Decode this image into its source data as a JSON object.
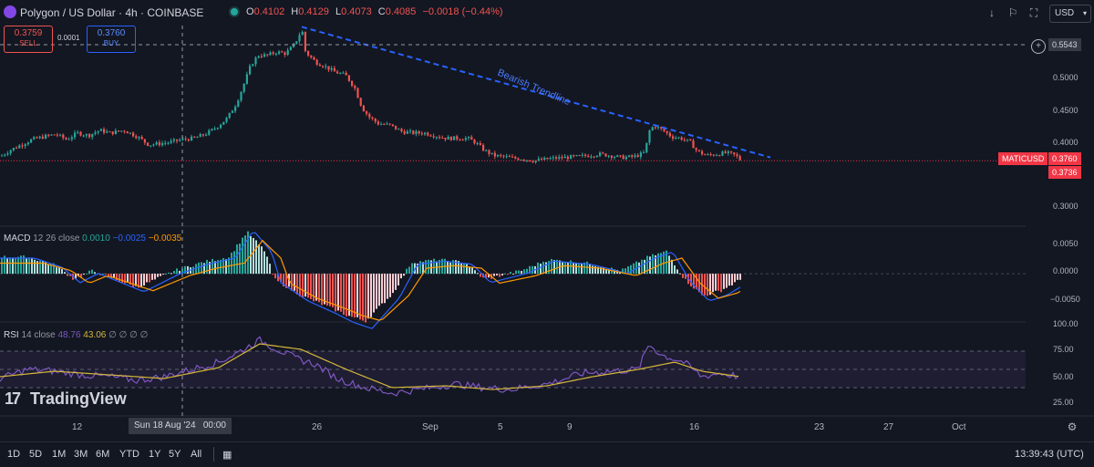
{
  "header": {
    "symbol_title": "Polygon / US Dollar · 4h · COINBASE",
    "ohlc": [
      {
        "k": "O",
        "v": "0.4102"
      },
      {
        "k": "H",
        "v": "0.4129"
      },
      {
        "k": "L",
        "v": "0.4073"
      },
      {
        "k": "C",
        "v": "0.4085"
      },
      {
        "k": "",
        "v": "−0.0018 (−0.44%)"
      }
    ],
    "currency": "USD"
  },
  "trade": {
    "sell_price": "0.3759",
    "sell_label": "SELL",
    "spread": "0.0001",
    "buy_price": "0.3760",
    "buy_label": "BUY"
  },
  "price_axis": {
    "ticks": [
      "0.5000",
      "0.4500",
      "0.4000",
      "0.3000"
    ],
    "crosshair_value": "0.5543",
    "symbol_tag": "MATICUSD",
    "last_price": "0.3760",
    "countdown": "0.3736"
  },
  "annotation": {
    "trendline_label": "Bearish Trendline"
  },
  "macd": {
    "label": "MACD",
    "params": "12 26 close",
    "v1": "0.0010",
    "v2": "−0.0025",
    "v3": "−0.0035",
    "ticks": [
      "0.0050",
      "0.0000",
      "−0.0050"
    ]
  },
  "rsi": {
    "label": "RSI",
    "params": "14 close",
    "v1": "48.76",
    "v2": "43.06",
    "extra": "∅ ∅ ∅ ∅",
    "ticks": [
      "100.00",
      "75.00",
      "50.00",
      "25.00"
    ]
  },
  "watermark": "TradingView",
  "time_axis": {
    "labels": [
      "12",
      "26",
      "Sep",
      "5",
      "9",
      "16",
      "23",
      "27",
      "Oct"
    ],
    "crosshair_date": "Sun 18 Aug '24",
    "crosshair_time": "00:00"
  },
  "bottom_bar": {
    "ranges": [
      "1D",
      "5D",
      "1M",
      "3M",
      "6M",
      "YTD",
      "1Y",
      "5Y",
      "All"
    ],
    "clock": "13:39:43 (UTC)"
  },
  "colors": {
    "up": "#26a69a",
    "down": "#ef5350",
    "trendline": "#2962ff",
    "macd_line": "#2962ff",
    "signal_line": "#ff9800",
    "rsi_line": "#7e57c2",
    "rsi_ma": "#d4b73a",
    "price_line": "#f23645",
    "background": "#131722"
  },
  "chart_data": {
    "type": "candlestick",
    "symbol": "MATICUSD",
    "interval": "4h",
    "price_ylim": [
      0.28,
      0.58
    ],
    "price_path": [
      [
        0,
        0.383
      ],
      [
        10,
        0.392
      ],
      [
        22,
        0.4
      ],
      [
        34,
        0.408
      ],
      [
        46,
        0.412
      ],
      [
        60,
        0.416
      ],
      [
        72,
        0.408
      ],
      [
        84,
        0.418
      ],
      [
        96,
        0.414
      ],
      [
        108,
        0.422
      ],
      [
        120,
        0.418
      ],
      [
        135,
        0.422
      ],
      [
        150,
        0.412
      ],
      [
        162,
        0.4
      ],
      [
        174,
        0.402
      ],
      [
        186,
        0.404
      ],
      [
        198,
        0.408
      ],
      [
        212,
        0.41
      ],
      [
        224,
        0.416
      ],
      [
        236,
        0.426
      ],
      [
        248,
        0.44
      ],
      [
        258,
        0.462
      ],
      [
        266,
        0.49
      ],
      [
        274,
        0.52
      ],
      [
        282,
        0.535
      ],
      [
        292,
        0.535
      ],
      [
        302,
        0.54
      ],
      [
        312,
        0.538
      ],
      [
        320,
        0.548
      ],
      [
        326,
        0.562
      ],
      [
        330,
        0.575
      ],
      [
        334,
        0.54
      ],
      [
        345,
        0.525
      ],
      [
        356,
        0.518
      ],
      [
        366,
        0.51
      ],
      [
        378,
        0.505
      ],
      [
        388,
        0.486
      ],
      [
        396,
        0.456
      ],
      [
        404,
        0.442
      ],
      [
        414,
        0.432
      ],
      [
        426,
        0.43
      ],
      [
        440,
        0.42
      ],
      [
        452,
        0.418
      ],
      [
        464,
        0.418
      ],
      [
        476,
        0.414
      ],
      [
        488,
        0.41
      ],
      [
        500,
        0.41
      ],
      [
        512,
        0.41
      ],
      [
        520,
        0.404
      ],
      [
        530,
        0.392
      ],
      [
        540,
        0.384
      ],
      [
        552,
        0.382
      ],
      [
        562,
        0.38
      ],
      [
        572,
        0.379
      ],
      [
        584,
        0.376
      ],
      [
        596,
        0.378
      ],
      [
        608,
        0.38
      ],
      [
        620,
        0.381
      ],
      [
        632,
        0.382
      ],
      [
        644,
        0.384
      ],
      [
        656,
        0.386
      ],
      [
        668,
        0.384
      ],
      [
        680,
        0.381
      ],
      [
        694,
        0.382
      ],
      [
        706,
        0.388
      ],
      [
        712,
        0.425
      ],
      [
        718,
        0.428
      ],
      [
        726,
        0.422
      ],
      [
        736,
        0.412
      ],
      [
        746,
        0.41
      ],
      [
        756,
        0.404
      ],
      [
        764,
        0.39
      ],
      [
        774,
        0.384
      ],
      [
        786,
        0.386
      ],
      [
        796,
        0.388
      ],
      [
        806,
        0.384
      ],
      [
        812,
        0.376
      ]
    ],
    "bearish_trendline": [
      [
        331,
        0.578
      ],
      [
        845,
        0.381
      ]
    ],
    "macd_ylim": [
      -0.0085,
      0.0082
    ],
    "macd_histogram_shape": [
      [
        0,
        0.003
      ],
      [
        30,
        0.003
      ],
      [
        60,
        0.0015
      ],
      [
        80,
        -0.001
      ],
      [
        100,
        0.0005
      ],
      [
        150,
        -0.0025
      ],
      [
        170,
        -0.001
      ],
      [
        190,
        0.0005
      ],
      [
        220,
        0.002
      ],
      [
        250,
        0.003
      ],
      [
        270,
        0.0075
      ],
      [
        290,
        0.004
      ],
      [
        300,
        -0.001
      ],
      [
        330,
        -0.004
      ],
      [
        360,
        -0.006
      ],
      [
        380,
        -0.0075
      ],
      [
        400,
        -0.0085
      ],
      [
        430,
        -0.0035
      ],
      [
        450,
        0.002
      ],
      [
        480,
        0.0025
      ],
      [
        510,
        0.002
      ],
      [
        530,
        -0.001
      ],
      [
        570,
        0.0005
      ],
      [
        600,
        0.0025
      ],
      [
        640,
        0.002
      ],
      [
        680,
        0.0005
      ],
      [
        710,
        0.003
      ],
      [
        730,
        0.004
      ],
      [
        750,
        -0.001
      ],
      [
        770,
        -0.004
      ],
      [
        790,
        -0.003
      ],
      [
        812,
        -0.001
      ]
    ],
    "rsi_ylim": [
      0,
      100
    ],
    "rsi_bands": [
      30,
      50,
      70
    ],
    "rsi_shape": [
      [
        0,
        40
      ],
      [
        30,
        50
      ],
      [
        60,
        48
      ],
      [
        90,
        44
      ],
      [
        120,
        42
      ],
      [
        150,
        38
      ],
      [
        180,
        42
      ],
      [
        210,
        50
      ],
      [
        240,
        58
      ],
      [
        260,
        68
      ],
      [
        285,
        82
      ],
      [
        300,
        74
      ],
      [
        325,
        62
      ],
      [
        345,
        56
      ],
      [
        370,
        40
      ],
      [
        400,
        30
      ],
      [
        430,
        24
      ],
      [
        460,
        28
      ],
      [
        500,
        34
      ],
      [
        530,
        30
      ],
      [
        560,
        28
      ],
      [
        600,
        34
      ],
      [
        640,
        46
      ],
      [
        670,
        48
      ],
      [
        700,
        50
      ],
      [
        712,
        78
      ],
      [
        725,
        66
      ],
      [
        750,
        58
      ],
      [
        770,
        42
      ],
      [
        790,
        46
      ],
      [
        812,
        42
      ]
    ],
    "rsi_ma_shape": [
      [
        0,
        42
      ],
      [
        60,
        48
      ],
      [
        120,
        44
      ],
      [
        180,
        40
      ],
      [
        240,
        52
      ],
      [
        285,
        78
      ],
      [
        330,
        72
      ],
      [
        380,
        50
      ],
      [
        430,
        30
      ],
      [
        490,
        32
      ],
      [
        540,
        28
      ],
      [
        600,
        32
      ],
      [
        650,
        42
      ],
      [
        700,
        50
      ],
      [
        740,
        58
      ],
      [
        770,
        48
      ],
      [
        812,
        42
      ]
    ]
  }
}
